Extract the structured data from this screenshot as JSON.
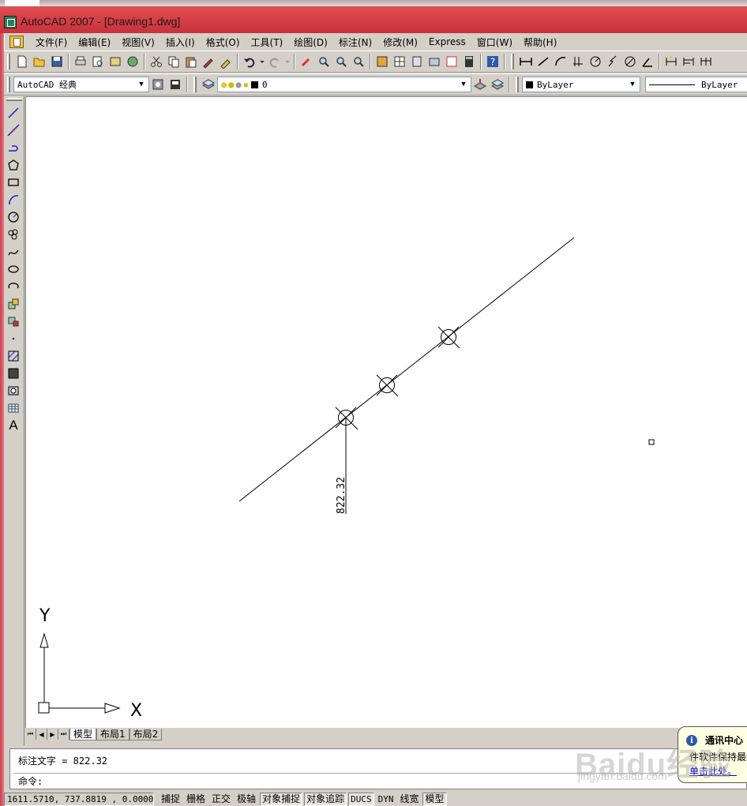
{
  "window": {
    "title": "AutoCAD 2007 - [Drawing1.dwg]"
  },
  "menu": {
    "items": [
      "文件(F)",
      "编辑(E)",
      "视图(V)",
      "插入(I)",
      "格式(O)",
      "工具(T)",
      "绘图(D)",
      "标注(N)",
      "修改(M)",
      "Express",
      "窗口(W)",
      "帮助(H)"
    ]
  },
  "toolbar2": {
    "workspace": "AutoCAD 经典",
    "layer": "0",
    "color": "ByLayer",
    "linetype": "ByLayer"
  },
  "drawing": {
    "dimension_text": "822.32",
    "ucs_x_label": "X",
    "ucs_y_label": "Y"
  },
  "layout_tabs": [
    "模型",
    "布局1",
    "布局2"
  ],
  "command": {
    "history": "标注文字 = 822.32",
    "prompt": "命令:"
  },
  "comm_center": {
    "title": "通讯中心",
    "text": "件软件保持最新",
    "link": "单击此处。"
  },
  "statusbar": {
    "coords": "1611.5710, 737.8819 , 0.0000",
    "buttons": [
      {
        "label": "捕捉",
        "on": false
      },
      {
        "label": "栅格",
        "on": false
      },
      {
        "label": "正交",
        "on": false
      },
      {
        "label": "极轴",
        "on": false
      },
      {
        "label": "对象捕捉",
        "on": true
      },
      {
        "label": "对象追踪",
        "on": true
      },
      {
        "label": "DUCS",
        "on": true
      },
      {
        "label": "DYN",
        "on": false
      },
      {
        "label": "线宽",
        "on": false
      },
      {
        "label": "模型",
        "on": true
      }
    ]
  },
  "watermark": {
    "text": "Baidu经验",
    "url": "jingyan.baidu.com"
  }
}
